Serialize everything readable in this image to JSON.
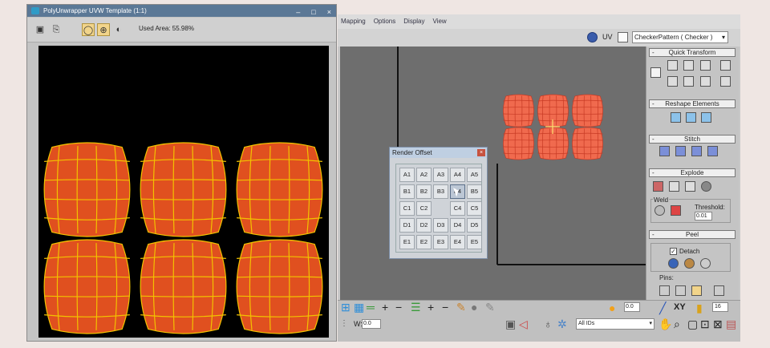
{
  "left_window": {
    "title": "PolyUnwrapper UVW Template (1:1)",
    "controls": [
      "–",
      "□",
      "×"
    ],
    "toolbar": {
      "icons": [
        "save-icon",
        "copy-icon",
        "circle-icon",
        "target-icon",
        "contrast-icon"
      ],
      "used_area_label": "Used Area: 55.98%"
    },
    "canvas": {
      "background": "#000000",
      "tile_fill": "#e0501f",
      "grid_color": "#f2c200"
    }
  },
  "main_window": {
    "menu": [
      "Mapping",
      "Options",
      "Display",
      "View"
    ],
    "uv_label": "UV",
    "checker_dropdown": "CheckerPattern ( Checker )",
    "viewport": {
      "background": "#6e6e6e",
      "tile_fill": "#f06a4e"
    },
    "panel": {
      "sections": [
        "Quick Transform",
        "Reshape Elements",
        "Stitch",
        "Explode",
        "Peel"
      ],
      "weld_label": "Weld",
      "threshold_label": "Threshold:",
      "threshold_value": "0.01",
      "detach_label": "Detach",
      "pins_label": "Pins:"
    },
    "bottom": {
      "zoom_value": "0.0",
      "xy_label": "XY",
      "size_value": "16",
      "w_label": "W:",
      "w_value": "0.0",
      "ids_dropdown": "All IDs"
    }
  },
  "render_offset": {
    "title": "Render Offset",
    "rows": [
      [
        "A1",
        "A2",
        "A3",
        "A4",
        "A5"
      ],
      [
        "B1",
        "B2",
        "B3",
        "B4",
        "B5"
      ],
      [
        "C1",
        "C2",
        "",
        "C4",
        "C5"
      ],
      [
        "D1",
        "D2",
        "D3",
        "D4",
        "D5"
      ],
      [
        "E1",
        "E2",
        "E3",
        "E4",
        "E5"
      ]
    ],
    "hovered": "B4"
  }
}
